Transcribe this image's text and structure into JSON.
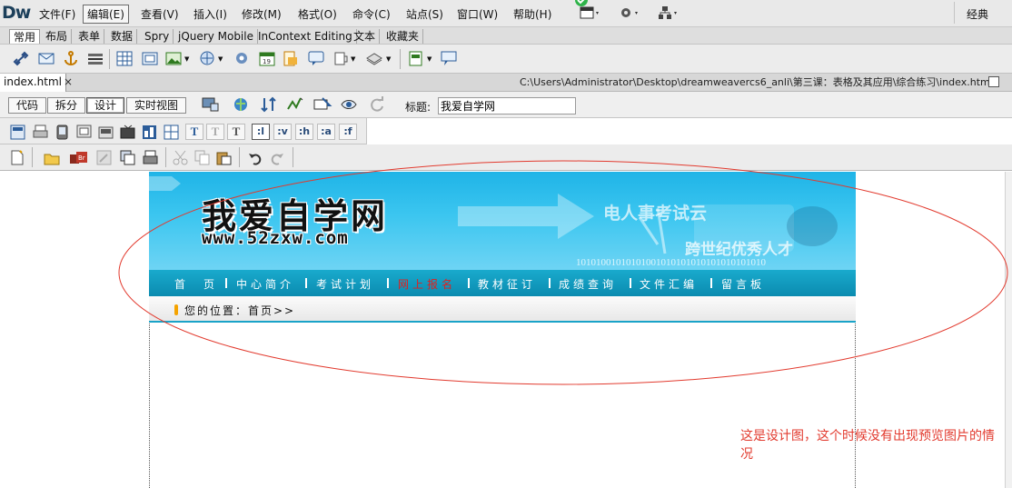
{
  "app": {
    "logo": "Dw",
    "workspace": "经典"
  },
  "menu": [
    "文件(F)",
    "编辑(E)",
    "查看(V)",
    "插入(I)",
    "修改(M)",
    "格式(O)",
    "命令(C)",
    "站点(S)",
    "窗口(W)",
    "帮助(H)"
  ],
  "menu_active": "编辑(E)",
  "insert_tabs": [
    "常用",
    "布局",
    "表单",
    "数据",
    "Spry",
    "jQuery Mobile",
    "InContext Editing",
    "文本",
    "收藏夹"
  ],
  "document": {
    "tab": "index.html",
    "close": "×",
    "path": "C:\\Users\\Administrator\\Desktop\\dreamweavercs6_anli\\第三课：表格及其应用\\综合练习\\index.html"
  },
  "view_buttons": [
    "代码",
    "拆分",
    "设计",
    "实时视图"
  ],
  "view_active": "设计",
  "title_label": "标题:",
  "title_value": "我爱自学网",
  "style_buttons": [
    ":l",
    ":v",
    ":h",
    ":a",
    ":f"
  ],
  "page": {
    "brand": "我爱自学网",
    "url": "www.52zxw.com",
    "tagline1": "电人事考试云",
    "tagline2": "跨世纪优秀人才",
    "binary": "10101001010101001010101010101010101010",
    "nav": [
      "首　页",
      "中心简介",
      "考试计划",
      "网上报名",
      "教材征订",
      "成绩查询",
      "文件汇编",
      "留言板"
    ],
    "nav_highlight": "网上报名",
    "breadcrumb": "您的位置：首页>>"
  },
  "annotation": "这是设计图，这个时候没有出现预览图片的情况",
  "colors": {
    "annotation": "#e23a2e",
    "banner": "#1fb4e7",
    "nav": "#0b8bb0",
    "nav_highlight": "#e0201f",
    "crumb_marker": "#f5a300"
  }
}
